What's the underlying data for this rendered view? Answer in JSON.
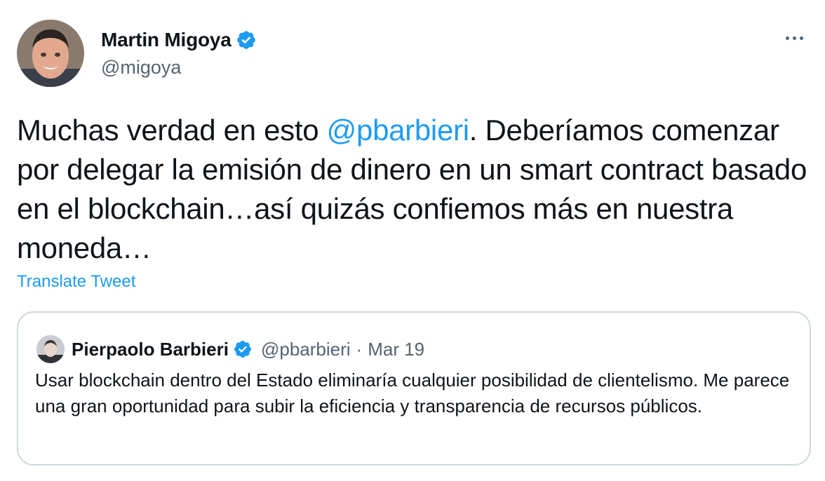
{
  "author": {
    "display_name": "Martin Migoya",
    "handle": "@migoya",
    "avatar_icon": "user-avatar-photo",
    "verified": true
  },
  "more_icon": "more-horizontal-icon",
  "tweet": {
    "text_before": "Muchas verdad en esto ",
    "mention": "@pbarbieri",
    "text_after": ". Deberíamos comenzar por delegar la emisión de dinero en un smart contract basado en el blockchain…así quizás confiemos más en nuestra moneda…"
  },
  "translate_label": "Translate Tweet",
  "quoted": {
    "display_name": "Pierpaolo Barbieri",
    "handle": "@pbarbieri",
    "separator": "·",
    "date": "Mar 19",
    "text": "Usar blockchain dentro del Estado eliminaría cualquier posibilidad de clientelismo. Me parece una gran oportunidad para subir la eficiencia y transparencia de recursos públicos."
  },
  "colors": {
    "accent": "#1d9bf0",
    "text_primary": "#0f1419",
    "text_secondary": "#536471",
    "border": "#cfd9de"
  }
}
